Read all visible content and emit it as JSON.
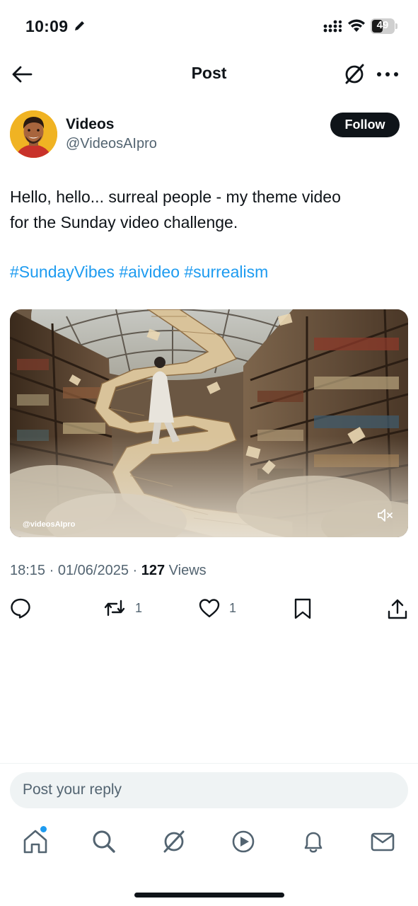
{
  "status_bar": {
    "time": "10:09",
    "battery_level": 49,
    "battery_text": "49"
  },
  "header": {
    "title": "Post",
    "back_icon": "arrow-left-icon",
    "grok_icon": "grok-icon",
    "more_icon": "more-icon"
  },
  "author": {
    "name": "Videos",
    "handle": "@VideosAIpro",
    "follow_label": "Follow"
  },
  "post": {
    "text_line1": "Hello, hello... surreal people -  my theme video",
    "text_line2": "for the Sunday video challenge.",
    "hashtags": [
      "#SundayVibes",
      "#aivideo",
      "#surrealism"
    ]
  },
  "media": {
    "watermark": "@videosAIpro",
    "mute_icon": "speaker-muted-icon"
  },
  "meta": {
    "time": "18:15",
    "separator": " · ",
    "date": "01/06/2025",
    "views_count": "127",
    "views_label": " Views"
  },
  "actions": {
    "reply_count": "",
    "repost_count": "1",
    "like_count": "1",
    "bookmark_count": "",
    "share_count": ""
  },
  "reply": {
    "placeholder": "Post your reply"
  },
  "tabs": [
    "home-icon",
    "search-icon",
    "grok-icon",
    "video-icon",
    "notifications-icon",
    "messages-icon"
  ],
  "colors": {
    "accent": "#1d9bf0",
    "text": "#0f1419",
    "secondary_text": "#536471",
    "reply_bg": "#eff3f4"
  }
}
